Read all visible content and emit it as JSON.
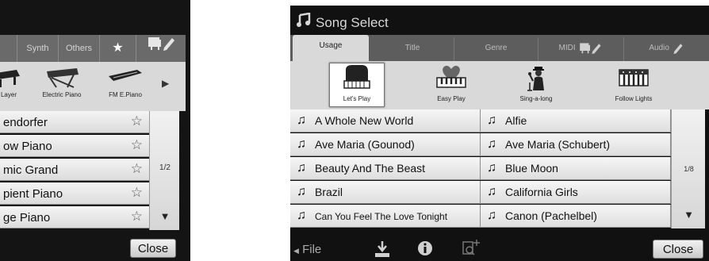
{
  "left": {
    "tabs": [
      "Synth",
      "Others"
    ],
    "icons": [
      "Layer",
      "Electric Piano",
      "FM E.Piano"
    ],
    "songs": [
      "endorfer",
      "ow Piano",
      "mic Grand",
      "pient Piano",
      "ge Piano"
    ],
    "page": "1/2",
    "close": "Close"
  },
  "right": {
    "title": "Song Select",
    "tabs": [
      "Usage",
      "Title",
      "Genre",
      "MIDI",
      "Audio"
    ],
    "categories": [
      "Let's Play",
      "Easy Play",
      "Sing-a-long",
      "Follow Lights"
    ],
    "songs": [
      "A Whole New World",
      "Alfie",
      "Ave Maria (Gounod)",
      "Ave Maria (Schubert)",
      "Beauty And The Beast",
      "Blue Moon",
      "Brazil",
      "California Girls",
      "Can You Feel The Love Tonight",
      "Canon (Pachelbel)"
    ],
    "page": "1/8",
    "file": "File",
    "close": "Close"
  },
  "icons": {
    "song": "music-note-icon",
    "favorite": "star-icon",
    "page_down": "triangle-down-icon",
    "save": "download-icon",
    "info": "info-icon",
    "search": "search-plus-icon",
    "edit": "pencil-icon"
  }
}
